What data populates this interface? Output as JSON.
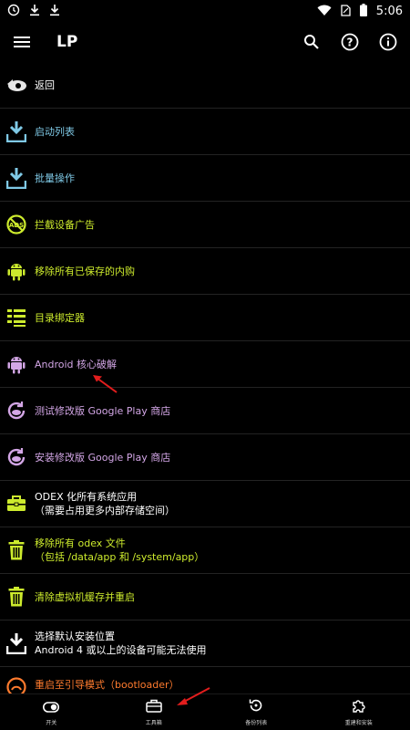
{
  "status": {
    "time": "5:06",
    "icons": [
      "alarm-icon",
      "download-icon",
      "download-icon",
      "wifi-icon",
      "sim-icon",
      "battery-icon"
    ]
  },
  "app_bar": {
    "title": "LP",
    "icons": [
      "menu-icon",
      "search-icon",
      "help-icon",
      "info-icon"
    ]
  },
  "colors": {
    "white": "#ffffff",
    "blue": "#7fc9e6",
    "green": "#cdeb2d",
    "purple": "#d3a6e6",
    "orange": "#ff7b2e",
    "arrow_red": "#e21d1d"
  },
  "menu_items": [
    {
      "label": "返回",
      "icon": "back-icon"
    },
    {
      "label": "启动列表",
      "icon": "download-box-icon"
    },
    {
      "label": "批量操作",
      "icon": "download-box-icon"
    },
    {
      "label": "拦截设备广告",
      "icon": "ads-block-icon"
    },
    {
      "label": "移除所有已保存的内购",
      "icon": "android-icon"
    },
    {
      "label": "目录绑定器",
      "icon": "list-bind-icon"
    },
    {
      "label": "Android 核心破解",
      "icon": "android-icon"
    },
    {
      "label": "测试修改版 Google Play 商店",
      "icon": "refresh-store-icon"
    },
    {
      "label": "安装修改版 Google Play 商店",
      "icon": "refresh-store-icon"
    },
    {
      "label": "ODEX 化所有系统应用",
      "sub": "（需要占用更多内部存储空间）",
      "icon": "toolbox-icon"
    },
    {
      "label": "移除所有 odex 文件",
      "sub": "（包括 /data/app 和 /system/app）",
      "icon": "trash-icon"
    },
    {
      "label": "清除虚拟机缓存并重启",
      "icon": "trash-icon"
    },
    {
      "label": "选择默认安装位置",
      "sub": "Android 4 或以上的设备可能无法使用",
      "icon": "download-box-icon"
    },
    {
      "label": "重启至引导模式（bootloader）",
      "icon": "reboot-icon"
    }
  ],
  "bottom_nav": [
    {
      "label": "开关",
      "icon": "toggle-icon"
    },
    {
      "label": "工具箱",
      "icon": "toolbox-icon"
    },
    {
      "label": "备份列表",
      "icon": "backup-icon"
    },
    {
      "label": "重建和安装",
      "icon": "puzzle-icon"
    }
  ]
}
